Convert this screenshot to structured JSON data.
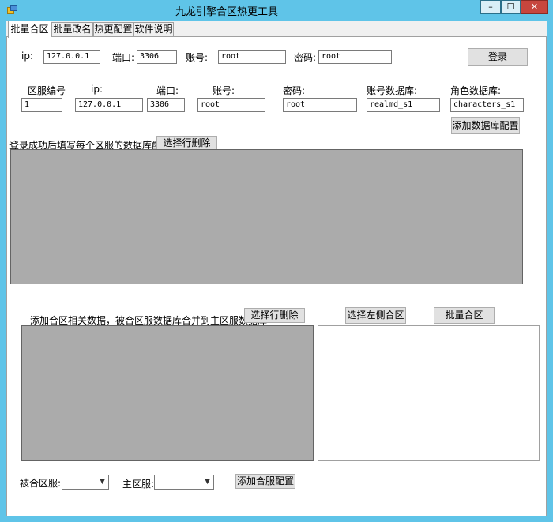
{
  "window": {
    "title": "九龙引擎合区热更工具",
    "minimize": "–",
    "maximize": "☐",
    "close": "✕"
  },
  "tabs": [
    "批量合区",
    "批量改名",
    "热更配置",
    "软件说明"
  ],
  "login": {
    "ip_label": "ip:",
    "ip_value": "127.0.0.1",
    "port_label": "端口:",
    "port_value": "3306",
    "account_label": "账号:",
    "account_value": "root",
    "password_label": "密码:",
    "password_value": "root",
    "login_button": "登录"
  },
  "db_config": {
    "zone_label": "区服编号",
    "zone_value": "1",
    "ip_label": "ip:",
    "ip_value": "127.0.0.1",
    "port_label": "端口:",
    "port_value": "3306",
    "account_label": "账号:",
    "account_value": "root",
    "password_label": "密码:",
    "password_value": "root",
    "account_db_label": "账号数据库:",
    "account_db_value": "realmd_s1",
    "role_db_label": "角色数据库:",
    "role_db_value": "characters_s1",
    "add_button": "添加数据库配置",
    "instruction": "登录成功后填写每个区服的数据库配置",
    "delete_row_button": "选择行删除"
  },
  "merge": {
    "instruction": "添加合区相关数据，被合区服数据库合并到主区服数据库",
    "delete_row_button": "选择行删除",
    "select_left_button": "选择左侧合区",
    "batch_merge_button": "批量合区",
    "merged_label": "被合区服:",
    "main_label": "主区服:",
    "add_config_button": "添加合服配置"
  }
}
